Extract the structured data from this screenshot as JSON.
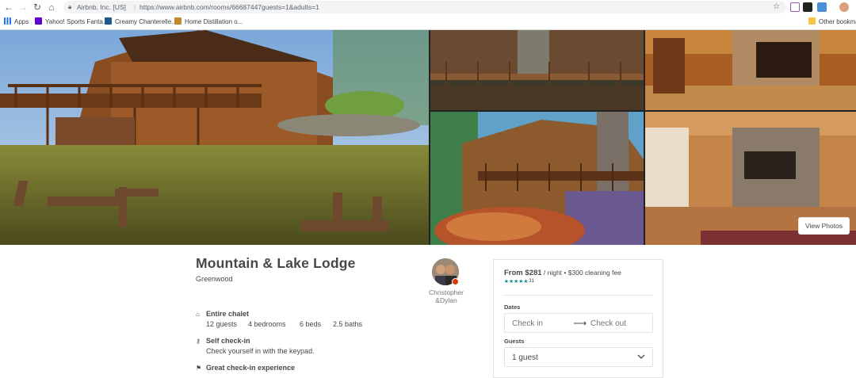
{
  "browser": {
    "site_identity": "Airbnb, Inc. [US]",
    "url": "https://www.airbnb.com/rooms/66687447guests=1&adults=1"
  },
  "bookmarks": {
    "apps": "Apps",
    "items": [
      "Yahoo! Sports Fanta...",
      "Creamy Chanterelle...",
      "Home Distillation o..."
    ],
    "other": "Other bookmar"
  },
  "photos": {
    "view_photos_label": "View Photos"
  },
  "listing": {
    "title": "Mountain & Lake Lodge",
    "location": "Greenwood",
    "host_name": "Christopher &Dylan",
    "features": [
      {
        "title": "Entire chalet",
        "icon": "house-icon"
      },
      {
        "title": "Self check-in",
        "desc": "Check yourself in with the keypad.",
        "icon": "key-icon"
      },
      {
        "title": "Great check-in experience",
        "icon": "flag-icon"
      }
    ],
    "stats": [
      "12 guests",
      "4 bedrooms",
      "6 beds",
      "2.5 baths"
    ]
  },
  "booking": {
    "price_prefix": "From ",
    "price": "$281",
    "price_unit": " / night",
    "cleaning_fee": "$300 cleaning fee",
    "stars": "★★★★★",
    "review_count": "31",
    "dates_label": "Dates",
    "check_in_placeholder": "Check in",
    "check_out_placeholder": "Check out",
    "guests_label": "Guests",
    "guests_value": "1 guest"
  }
}
